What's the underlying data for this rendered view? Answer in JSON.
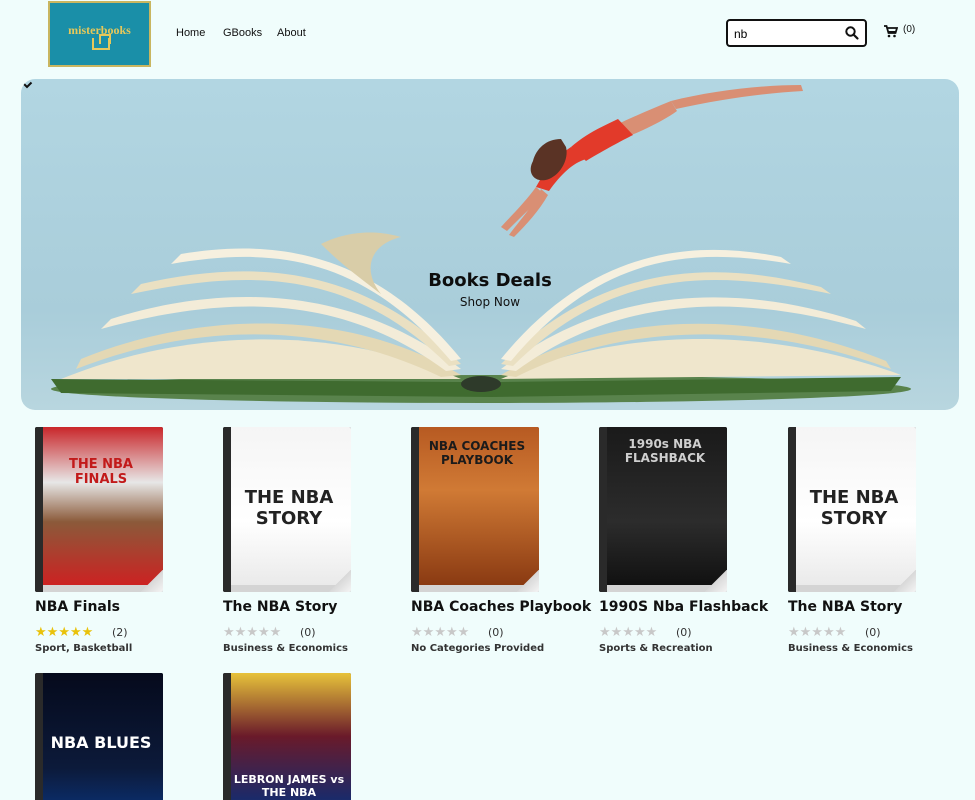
{
  "header": {
    "logo_text": "misterbooks",
    "nav": [
      "Home",
      "GBooks",
      "About"
    ],
    "search_value": "nb",
    "cart_count": "(0)"
  },
  "hero": {
    "title": "Books Deals",
    "subtitle": "Shop Now"
  },
  "colors": {
    "logo_bg": "#1a8fa8",
    "logo_gold": "#e6c85a",
    "page_bg": "#f0fdfc",
    "star_filled": "#e9c20b",
    "star_empty": "#c8c8c8"
  },
  "books": [
    {
      "title": "NBA Finals",
      "rating": 5,
      "count": "(2)",
      "category": "Sport, Basketball",
      "cover_text": "THE NBA FINALS"
    },
    {
      "title": "The NBA Story",
      "rating": 0,
      "count": "(0)",
      "category": "Business & Economics",
      "cover_text": "THE NBA STORY"
    },
    {
      "title": "NBA Coaches Playbook",
      "rating": 0,
      "count": "(0)",
      "category": "No Categories Provided",
      "cover_text": "NBA COACHES PLAYBOOK"
    },
    {
      "title": "1990S Nba Flashback",
      "rating": 0,
      "count": "(0)",
      "category": "Sports & Recreation",
      "cover_text": "1990s NBA FLASHBACK"
    },
    {
      "title": "The NBA Story",
      "rating": 0,
      "count": "(0)",
      "category": "Business & Economics",
      "cover_text": "THE NBA STORY"
    },
    {
      "title": "",
      "rating": 0,
      "count": "",
      "category": "",
      "cover_text": "NBA BLUES"
    },
    {
      "title": "",
      "rating": 0,
      "count": "",
      "category": "",
      "cover_text": "LEBRON JAMES vs THE NBA"
    }
  ]
}
